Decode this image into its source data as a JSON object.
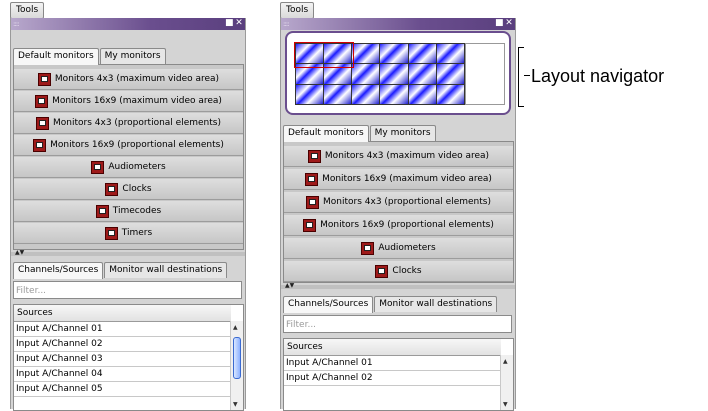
{
  "left_panel": {
    "tools_label": "Tools",
    "monitor_tabs": [
      "Default monitors",
      "My monitors"
    ],
    "monitors": [
      "Monitors 4x3 (maximum video area)",
      "Monitors 16x9 (maximum video area)",
      "Monitors 4x3 (proportional elements)",
      "Monitors 16x9 (proportional elements)",
      "Audiometers",
      "Clocks",
      "Timecodes",
      "Timers"
    ],
    "source_tabs": [
      "Channels/Sources",
      "Monitor wall destinations"
    ],
    "filter_placeholder": "Filter...",
    "sources_header": "Sources",
    "sources": [
      "Input A/Channel 01",
      "Input A/Channel 02",
      "Input A/Channel 03",
      "Input A/Channel 04",
      "Input A/Channel 05"
    ]
  },
  "right_panel": {
    "tools_label": "Tools",
    "monitor_tabs": [
      "Default monitors",
      "My monitors"
    ],
    "monitors": [
      "Monitors 4x3 (maximum video area)",
      "Monitors 16x9 (maximum video area)",
      "Monitors 4x3 (proportional elements)",
      "Monitors 16x9 (proportional elements)",
      "Audiometers",
      "Clocks"
    ],
    "source_tabs": [
      "Channels/Sources",
      "Monitor wall destinations"
    ],
    "filter_placeholder": "Filter...",
    "sources_header": "Sources",
    "sources": [
      "Input A/Channel 01",
      "Input A/Channel 02"
    ]
  },
  "annotation": {
    "label": "Layout navigator"
  },
  "colors": {
    "titlebar": "#5a3f7e",
    "navigator_border": "#6a4e8e",
    "monitor_icon": "#9e1a1a",
    "highlight": "#d00000"
  }
}
